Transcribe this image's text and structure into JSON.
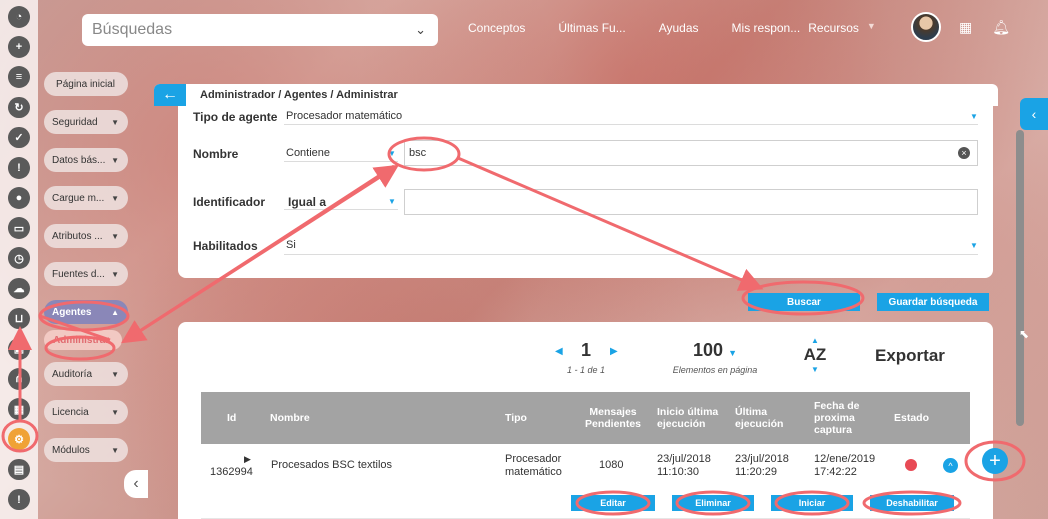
{
  "colors": {
    "accent": "#1aa3e5",
    "annotation": "#f06a6e",
    "status_red": "#e84a55",
    "header_gray": "#a3a3a3"
  },
  "rail": {
    "icons": [
      "pie-chart-icon",
      "plus-icon",
      "list-icon",
      "cycle-icon",
      "check-icon",
      "warning-icon",
      "users-icon",
      "monitor-icon",
      "clock-icon",
      "cloud-icon",
      "cart-icon",
      "gift-icon",
      "network-icon",
      "grid-icon",
      "gear-icon",
      "briefcase-icon",
      "alert-icon"
    ]
  },
  "topbar": {
    "search_label": "Búsquedas",
    "nav": [
      "Conceptos",
      "Últimas Fu...",
      "Ayudas",
      "Mis respon...",
      "Recursos"
    ]
  },
  "sidebar": {
    "home": "Página inicial",
    "items": [
      "Seguridad",
      "Datos bás...",
      "Cargue m...",
      "Atributos ...",
      "Fuentes d..."
    ],
    "agentes": "Agentes",
    "administrar": "Administrar",
    "items_after": [
      "Auditoría",
      "Licencia",
      "Módulos"
    ]
  },
  "breadcrumb": "Administrador / Agentes / Administrar",
  "filters": {
    "tipo_label": "Tipo de agente",
    "tipo_value": "Procesador matemático",
    "nombre_label": "Nombre",
    "nombre_op": "Contiene",
    "nombre_value": "bsc",
    "ident_label": "Identificador",
    "ident_op": "Igual a",
    "ident_value": "",
    "habil_label": "Habilitados",
    "habil_value": "Si",
    "buscar": "Buscar",
    "guardar": "Guardar búsqueda"
  },
  "pagination": {
    "page": "1",
    "range": "1 - 1 de 1",
    "per_page": "100",
    "per_page_label": "Elementos en página",
    "sort": "AZ",
    "export": "Exportar"
  },
  "table": {
    "headers": {
      "id": "Id",
      "nombre": "Nombre",
      "tipo": "Tipo",
      "mensajes": [
        "Mensajes",
        "Pendientes"
      ],
      "inicio": [
        "Inicio última",
        "ejecución"
      ],
      "ultima": [
        "Última",
        "ejecución"
      ],
      "fecha": [
        "Fecha de",
        "proxima",
        "captura"
      ],
      "estado": "Estado"
    },
    "row": {
      "id": "1362994",
      "nombre": "Procesados BSC textilos",
      "tipo": [
        "Procesador",
        "matemático"
      ],
      "mensajes": "1080",
      "inicio": [
        "23/jul/2018",
        "11:10:30"
      ],
      "ultima": [
        "23/jul/2018",
        "11:20:29"
      ],
      "fecha": [
        "12/ene/2019",
        "17:42:22"
      ]
    },
    "actions": [
      "Editar",
      "Eliminar",
      "Iniciar",
      "Deshabilitar"
    ]
  }
}
